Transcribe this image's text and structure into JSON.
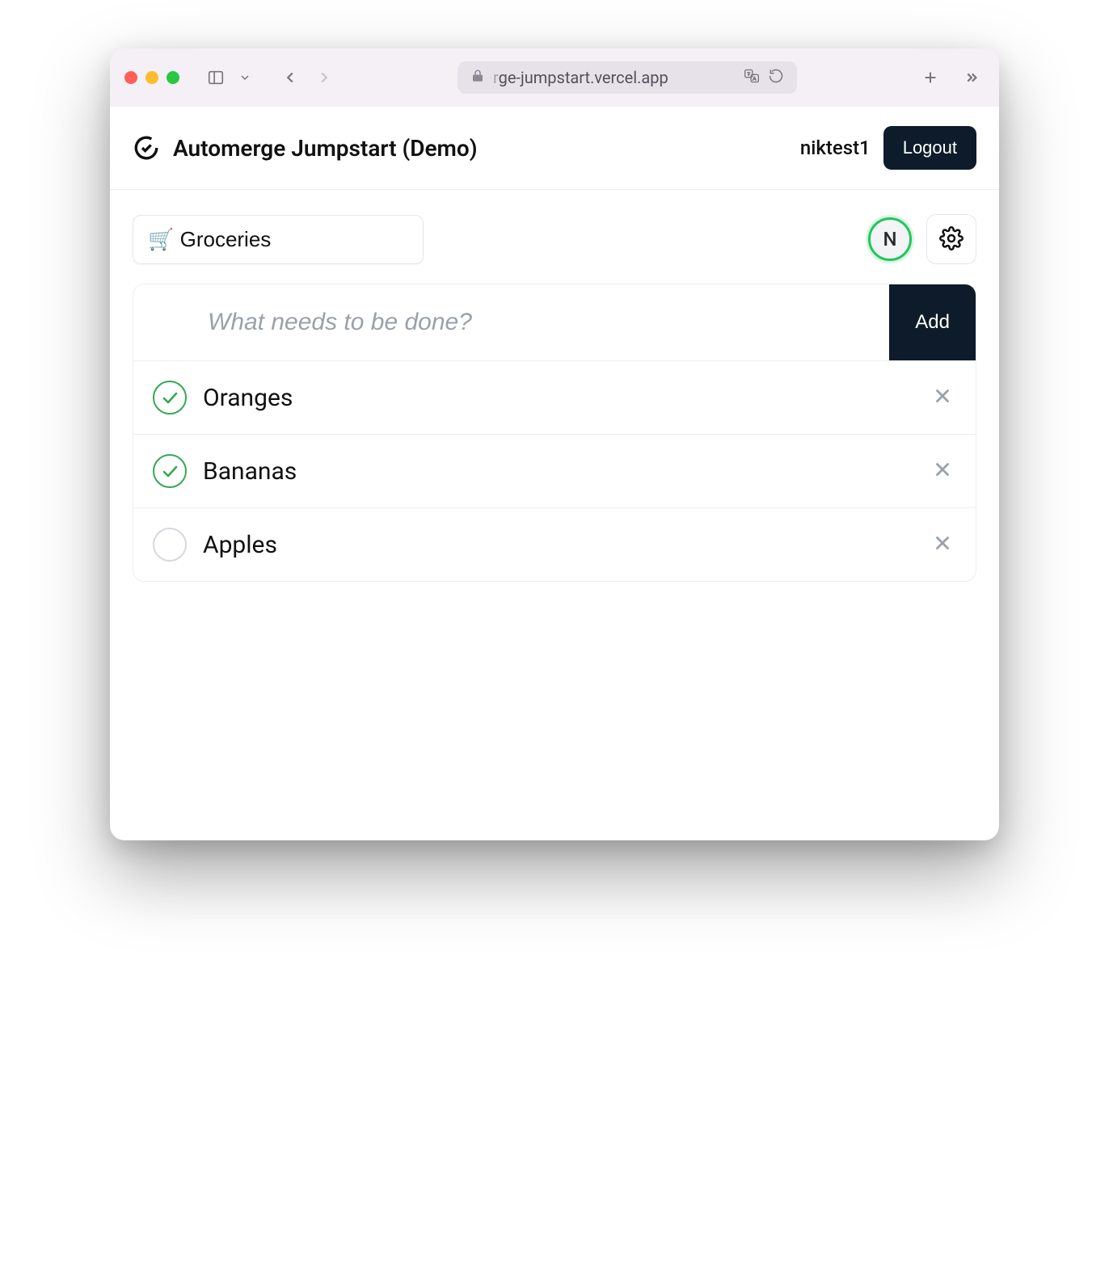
{
  "browser": {
    "url_visible": "ge-jumpstart.vercel.app"
  },
  "header": {
    "app_title": "Automerge Jumpstart  (Demo)",
    "username": "niktest1",
    "logout_label": "Logout"
  },
  "toolbar": {
    "list_name": "🛒 Groceries",
    "avatar_initial": "N"
  },
  "new_todo": {
    "placeholder": "What needs to be done?",
    "add_label": "Add"
  },
  "todos": [
    {
      "label": "Oranges",
      "done": true
    },
    {
      "label": "Bananas",
      "done": true
    },
    {
      "label": "Apples",
      "done": false
    }
  ]
}
